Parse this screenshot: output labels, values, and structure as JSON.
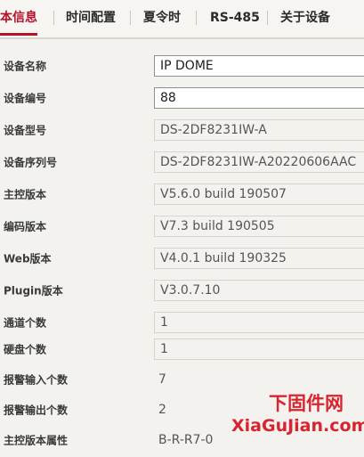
{
  "tabs": [
    {
      "label": "本信息",
      "active": true
    },
    {
      "label": "时间配置",
      "active": false
    },
    {
      "label": "夏令时",
      "active": false
    },
    {
      "label": "RS-485",
      "active": false
    },
    {
      "label": "关于设备",
      "active": false
    }
  ],
  "fields": {
    "device_name": {
      "label": "设备名称",
      "value": "IP DOME"
    },
    "device_number": {
      "label": "设备编号",
      "value": "88"
    },
    "device_model": {
      "label": "设备型号",
      "value": "DS-2DF8231IW-A"
    },
    "serial_number": {
      "label": "设备序列号",
      "value": "DS-2DF8231IW-A20220606AAC"
    },
    "firmware_version": {
      "label": "主控版本",
      "value": "V5.6.0 build 190507"
    },
    "encoding_version": {
      "label": "编码版本",
      "value": "V7.3 build 190505"
    },
    "web_version": {
      "label": "Web版本",
      "value": "V4.0.1 build 190325"
    },
    "plugin_version": {
      "label": "Plugin版本",
      "value": "V3.0.7.10"
    },
    "channel_count": {
      "label": "通道个数",
      "value": "1"
    },
    "disk_count": {
      "label": "硬盘个数",
      "value": "1"
    },
    "alarm_input_count": {
      "label": "报警输入个数",
      "value": "7"
    },
    "alarm_output_count": {
      "label": "报警输出个数",
      "value": "2"
    },
    "firmware_properties": {
      "label": "主控版本属性",
      "value": "B-R-R7-0"
    }
  },
  "watermark": {
    "cn": "下固件网",
    "en": "XiaGuJian.com"
  },
  "colors": {
    "accent": "#b5122b",
    "watermark": "#d9242f"
  }
}
